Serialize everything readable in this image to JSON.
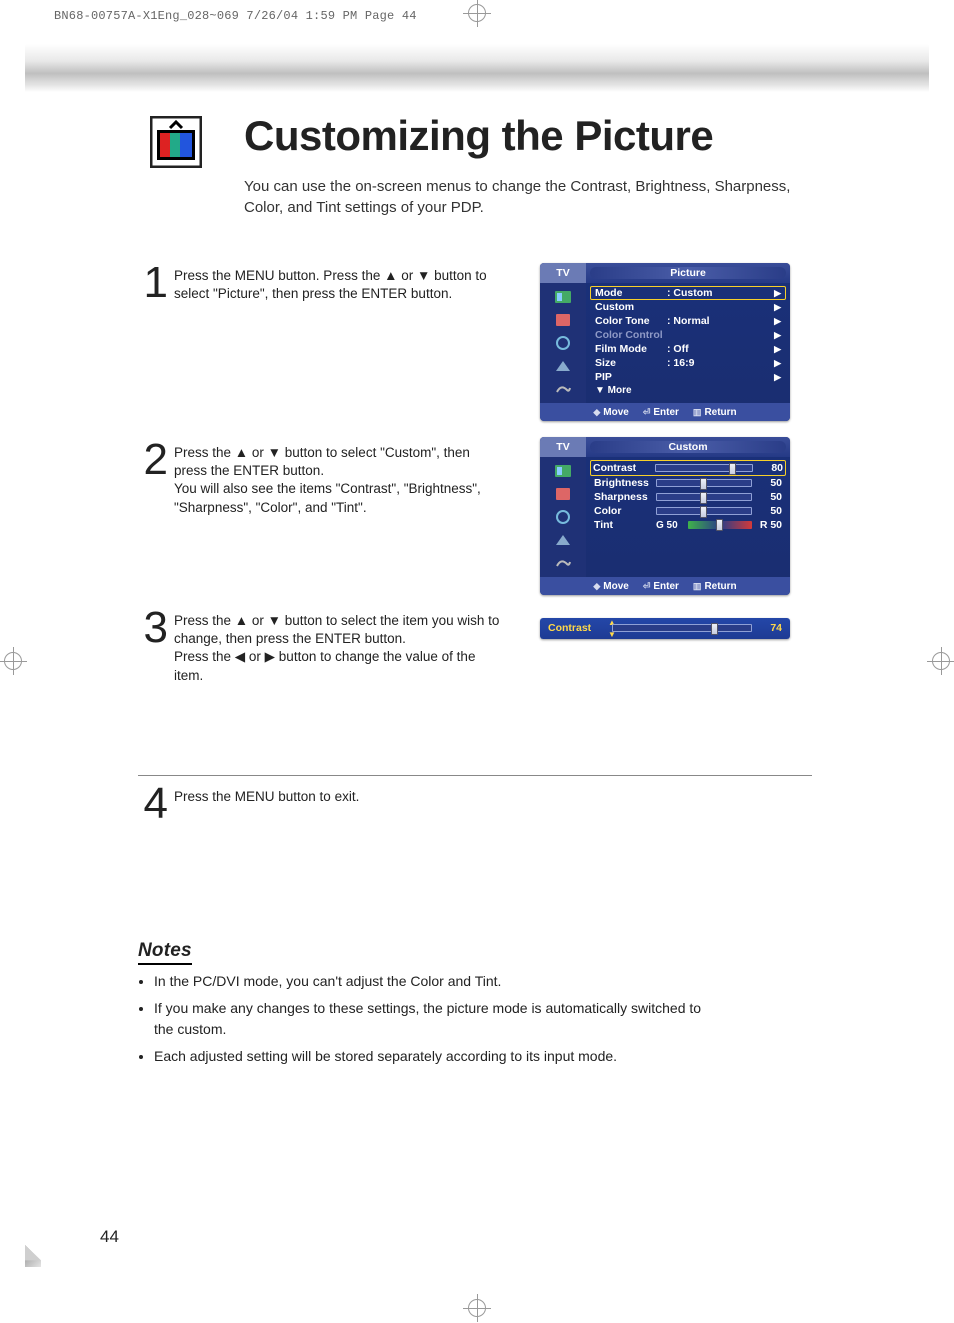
{
  "print_header": "BN68-00757A-X1Eng_028~069  7/26/04  1:59 PM  Page 44",
  "title": "Customizing the Picture",
  "subtitle": "You can use the on-screen menus to change the Contrast, Brightness, Sharpness, Color, and Tint settings of your PDP.",
  "steps": {
    "s1": {
      "num": "1",
      "text": "Press the MENU button. Press the ▲ or ▼ button to select \"Picture\", then press the ENTER button."
    },
    "s2": {
      "num": "2",
      "text": "Press the ▲ or ▼ button to select \"Custom\", then press the ENTER button.\nYou will also see the items \"Contrast\", \"Brightness\", \"Sharpness\", \"Color\", and \"Tint\"."
    },
    "s3": {
      "num": "3",
      "text": "Press the ▲ or ▼ button to select the item you wish to change, then press the ENTER button.\nPress the ◀ or ▶ button to change the value of the item."
    },
    "s4": {
      "num": "4",
      "text": "Press the MENU button to exit."
    }
  },
  "osd1": {
    "tv": "TV",
    "heading": "Picture",
    "rows": [
      {
        "label": "Mode",
        "value": ":  Custom",
        "highlight": true
      },
      {
        "label": "Custom",
        "value": ""
      },
      {
        "label": "Color Tone",
        "value": ":  Normal"
      },
      {
        "label": "Color Control",
        "value": "",
        "disabled": true
      },
      {
        "label": "Film Mode",
        "value": ":  Off"
      },
      {
        "label": "Size",
        "value": ":  16:9"
      },
      {
        "label": "PIP",
        "value": ""
      }
    ],
    "more": "▼ More",
    "footer": {
      "move": "Move",
      "enter": "Enter",
      "return": "Return"
    }
  },
  "osd2": {
    "tv": "TV",
    "heading": "Custom",
    "rows": [
      {
        "label": "Contrast",
        "value": "80",
        "pct": 80,
        "highlight": true
      },
      {
        "label": "Brightness",
        "value": "50",
        "pct": 50
      },
      {
        "label": "Sharpness",
        "value": "50",
        "pct": 50
      },
      {
        "label": "Color",
        "value": "50",
        "pct": 50
      },
      {
        "label": "Tint",
        "left": "G 50",
        "right": "R 50",
        "pct": 50,
        "tint": true
      }
    ],
    "footer": {
      "move": "Move",
      "enter": "Enter",
      "return": "Return"
    }
  },
  "osd3": {
    "label": "Contrast",
    "value": "74",
    "pct": 74
  },
  "notes": {
    "heading": "Notes",
    "items": [
      "In the PC/DVI mode, you can't adjust the Color and Tint.",
      "If you make any changes to these settings, the picture mode is automatically switched to the custom.",
      "Each adjusted setting will be stored separately according to its input mode."
    ]
  },
  "page_number": "44"
}
